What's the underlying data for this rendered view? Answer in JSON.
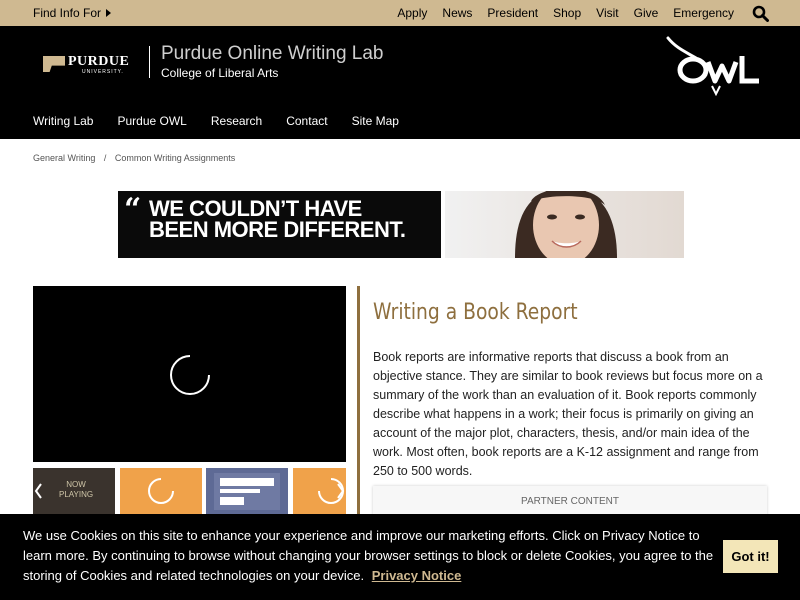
{
  "topbar": {
    "find_info": "Find Info For",
    "links": [
      "Apply",
      "News",
      "President",
      "Shop",
      "Visit",
      "Give",
      "Emergency"
    ]
  },
  "header": {
    "logo_name": "PURDUE",
    "logo_sub": "UNIVERSITY.",
    "site_title": "Purdue Online Writing Lab",
    "site_subtitle": "College of Liberal Arts",
    "nav": [
      "Writing Lab",
      "Purdue OWL",
      "Research",
      "Contact",
      "Site Map"
    ]
  },
  "breadcrumb": [
    "General Writing",
    "Common Writing Assignments"
  ],
  "ad": {
    "line1": "WE COULDN’T HAVE",
    "line2": "BEEN MORE DIFFERENT."
  },
  "video": {
    "thumb1_text": "NOW\nPLAYING"
  },
  "article": {
    "title": "Writing a Book Report",
    "body": "Book reports are informative reports that discuss a book from an objective stance. They are similar to book reviews but focus more on a summary of the work than an evaluation of it. Book reports commonly describe what happens in a work; their focus is primarily on giving an account of the major plot, characters, thesis, and/or main idea of the work. Most often, book reports are a K-12 assignment and range from 250 to 500 words.",
    "partner_label": "PARTNER CONTENT"
  },
  "cookie": {
    "text": "We use Cookies on this site to enhance your experience and improve our marketing efforts. Click on Privacy Notice to learn more. By continuing to browse without changing your browser settings to block or delete Cookies, you agree to the storing of Cookies and related technologies on your device.",
    "privacy_link": "Privacy Notice",
    "button": "Got it!"
  },
  "colors": {
    "gold": "#cfb991",
    "dark_gold": "#8e6f3e",
    "black": "#000000"
  }
}
